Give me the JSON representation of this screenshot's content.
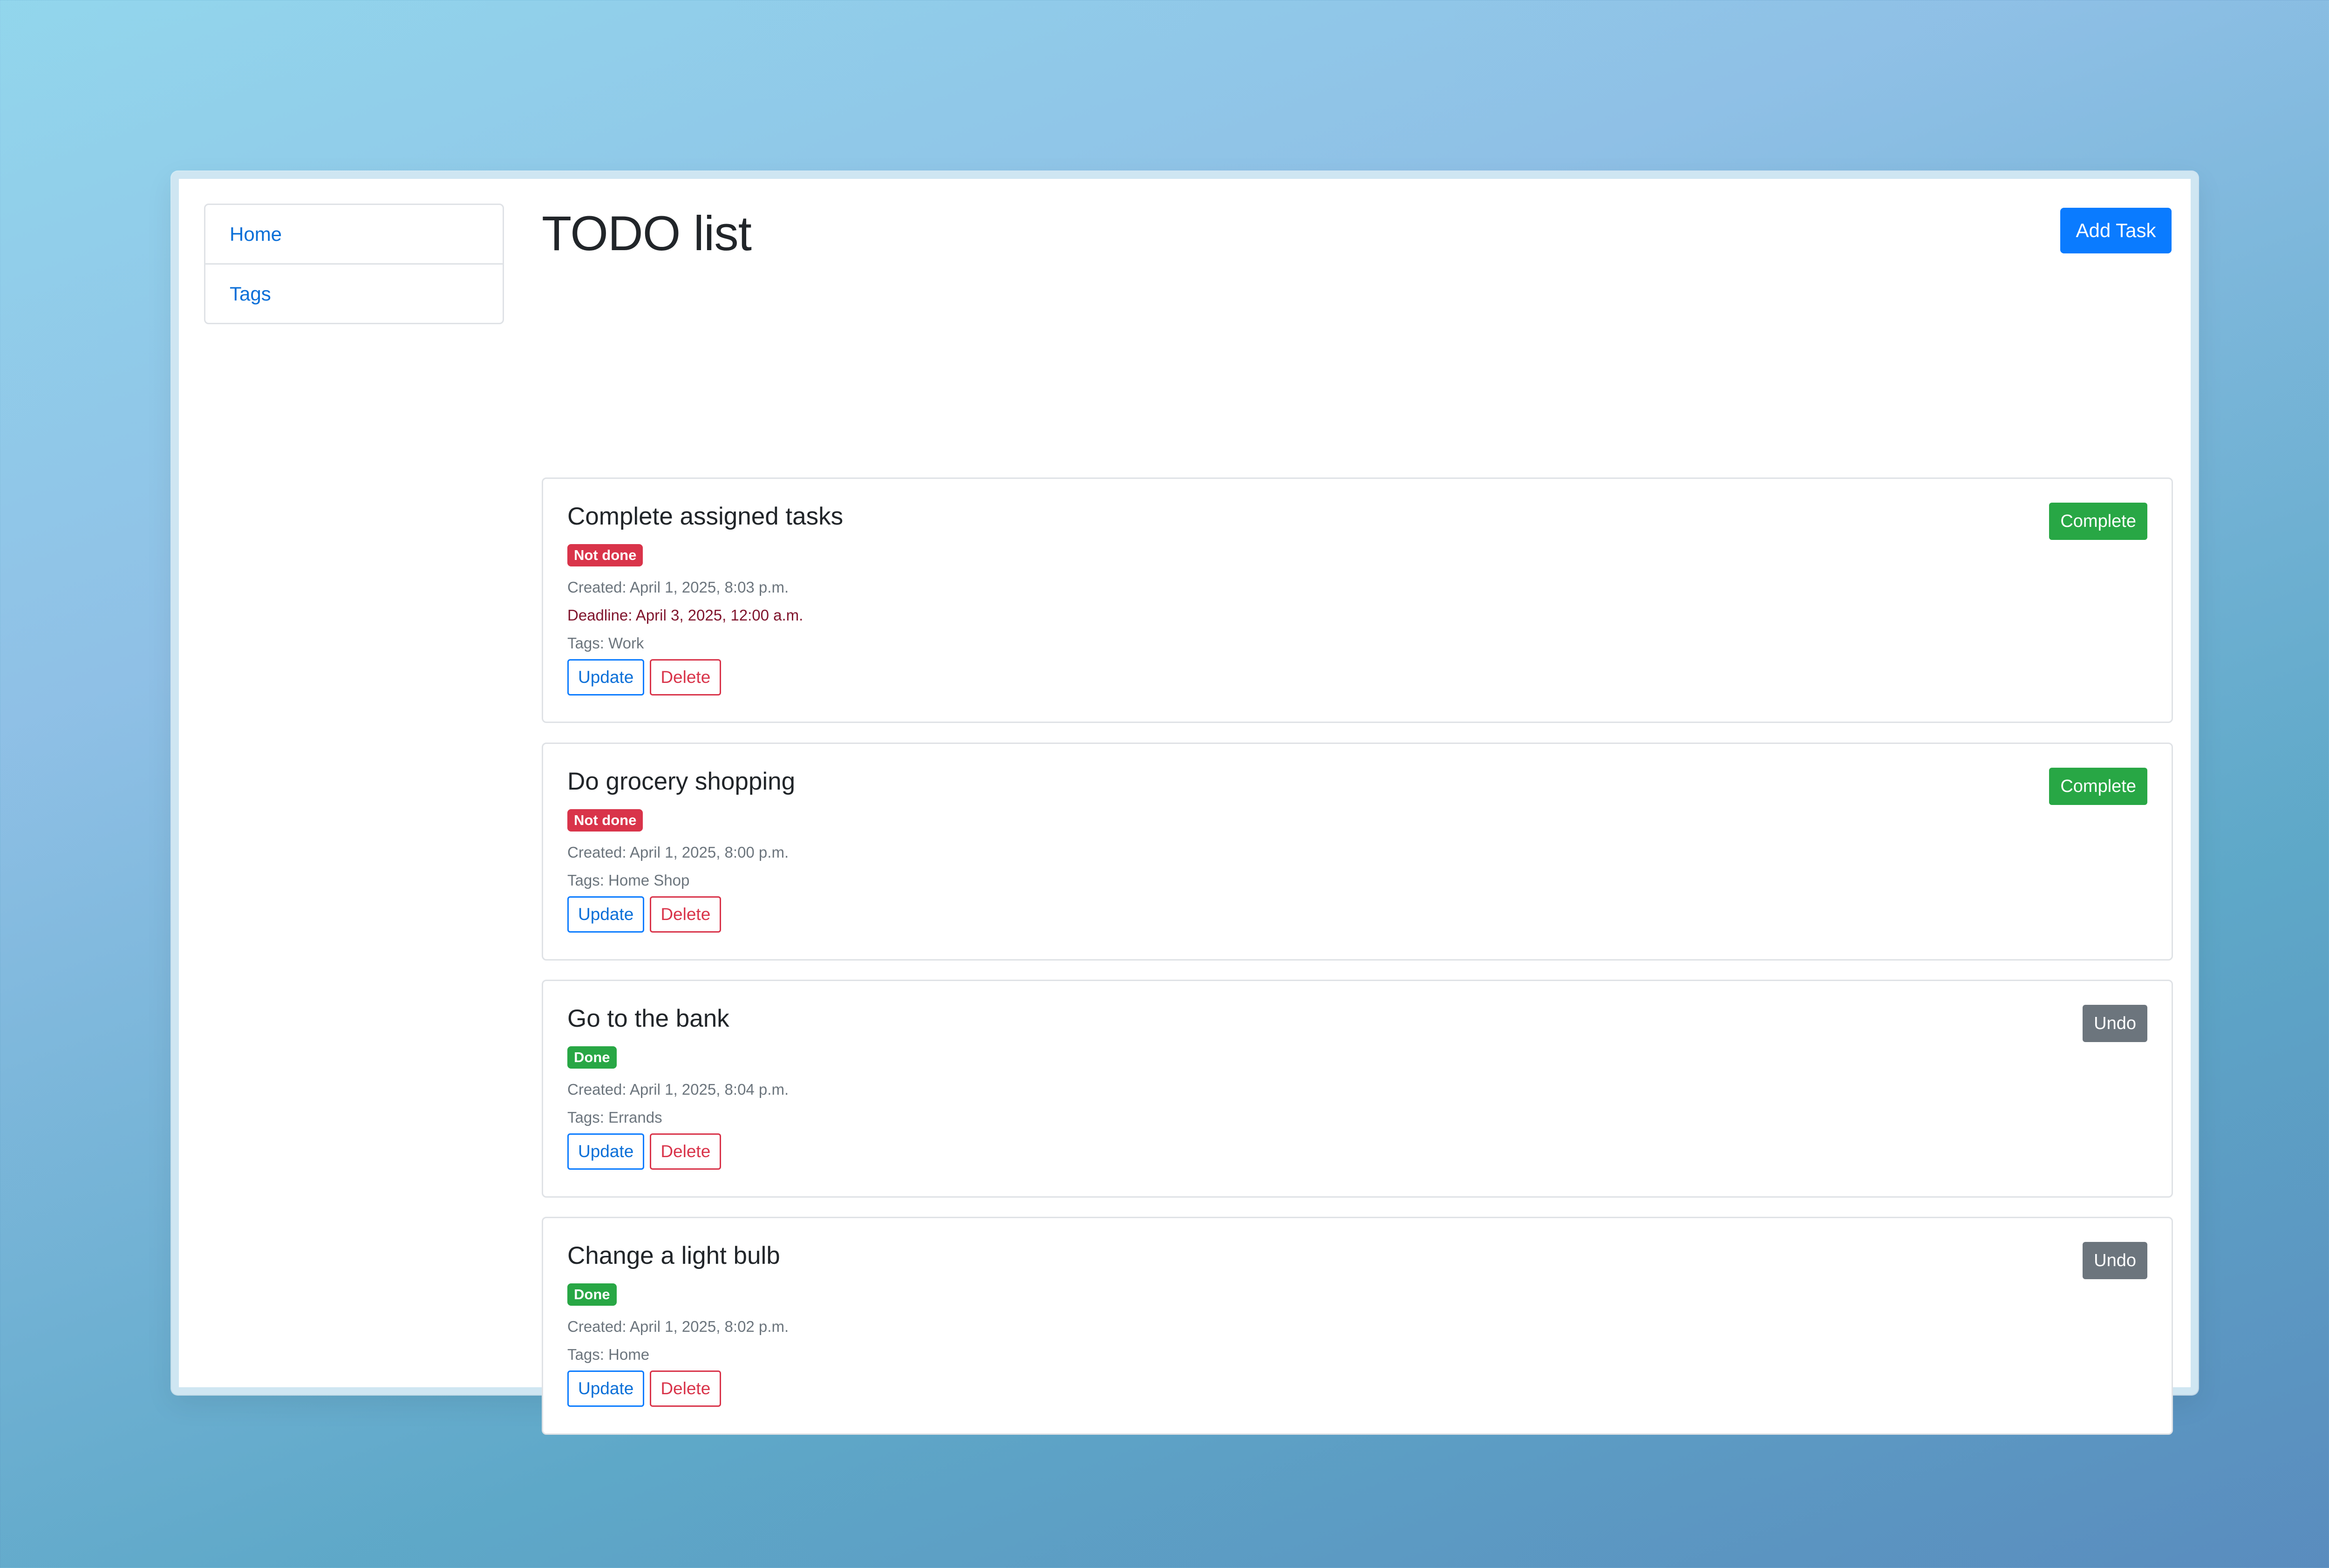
{
  "sidebar": {
    "items": [
      {
        "label": "Home"
      },
      {
        "label": "Tags"
      }
    ]
  },
  "header": {
    "title": "TODO list",
    "add_task_label": "Add Task"
  },
  "tasks": [
    {
      "title": "Complete assigned tasks",
      "status": "Not done",
      "created": "Created: April 1, 2025, 8:03 p.m.",
      "deadline": "Deadline: April 3, 2025, 12:00 a.m.",
      "tags": "Tags: Work",
      "update_label": "Update",
      "delete_label": "Delete",
      "action_label": "Complete"
    },
    {
      "title": "Do grocery shopping",
      "status": "Not done",
      "created": "Created: April 1, 2025, 8:00 p.m.",
      "tags": "Tags: Home Shop",
      "update_label": "Update",
      "delete_label": "Delete",
      "action_label": "Complete"
    },
    {
      "title": "Go to the bank",
      "status": "Done",
      "created": "Created: April 1, 2025, 8:04 p.m.",
      "tags": "Tags: Errands",
      "update_label": "Update",
      "delete_label": "Delete",
      "action_label": "Undo"
    },
    {
      "title": "Change a light bulb",
      "status": "Done",
      "created": "Created: April 1, 2025, 8:02 p.m.",
      "tags": "Tags: Home",
      "update_label": "Update",
      "delete_label": "Delete",
      "action_label": "Undo"
    }
  ],
  "colors": {
    "link": "#0a6fd8",
    "primary": "#0a7bff",
    "success": "#28a745",
    "danger": "#d9344a",
    "secondary": "#6c757d",
    "deadline": "#80152d"
  }
}
